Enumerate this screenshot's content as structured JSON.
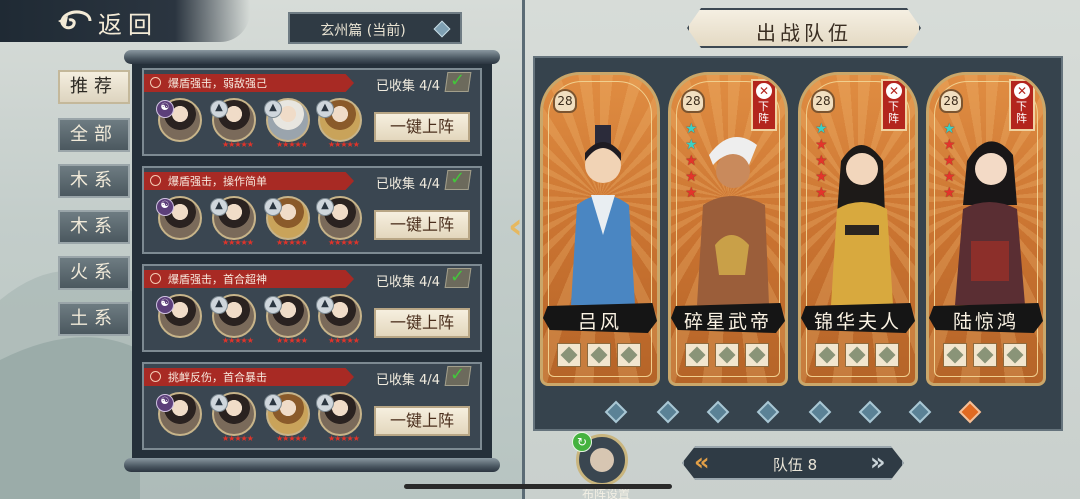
{
  "header": {
    "back_label": "返回",
    "chapter_label": "玄州篇 (当前)"
  },
  "filters": [
    "推荐",
    "全部",
    "木系",
    "木系",
    "火系",
    "土系"
  ],
  "lineups": [
    {
      "tag": "爆盾强击，弱敌强己",
      "collected": "已收集 4/4",
      "button": "一键上阵"
    },
    {
      "tag": "爆盾强击，操作简单",
      "collected": "已收集 4/4",
      "button": "一键上阵"
    },
    {
      "tag": "爆盾强击，首合超神",
      "collected": "已收集 4/4",
      "button": "一键上阵"
    },
    {
      "tag": "挑衅反伤，首合暴击",
      "collected": "已收集 4/4",
      "button": "一键上阵"
    }
  ],
  "team": {
    "title": "出战队伍",
    "remove_label": "下阵",
    "heroes": [
      {
        "name": "吕风",
        "level": "28",
        "removable": false
      },
      {
        "name": "碎星武帝",
        "level": "28",
        "removable": true
      },
      {
        "name": "锦华夫人",
        "level": "28",
        "removable": true
      },
      {
        "name": "陆惊鸿",
        "level": "28",
        "removable": true
      }
    ],
    "team_label": "队伍 8",
    "formation_label": "布阵设置",
    "page_count": 8,
    "active_page": 8
  },
  "colors": {
    "accent_red": "#a82a24",
    "card_orange": "#d47f38",
    "panel_dark": "#36434d"
  }
}
